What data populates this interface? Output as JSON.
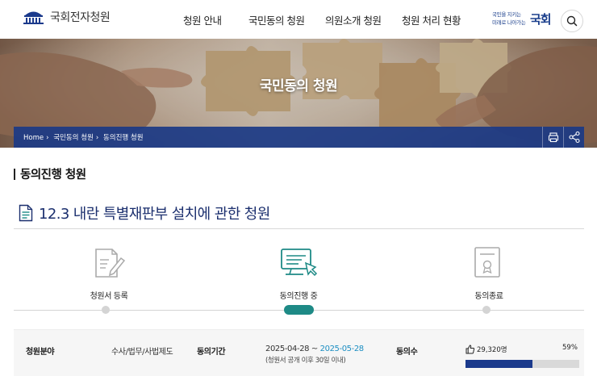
{
  "header": {
    "logo_text": "국회전자청원",
    "nav": [
      "청원 안내",
      "국민동의 청원",
      "의원소개 청원",
      "청원 처리 현황"
    ],
    "slogan_line1": "국민을 지키는",
    "slogan_line2": "미래로 나아가는",
    "slogan_brand": "국회",
    "search_icon": "search-icon"
  },
  "hero": {
    "title": "국민동의 청원",
    "breadcrumb": [
      "Home",
      "국민동의 청원",
      "동의진행 청원"
    ],
    "print_icon": "print-icon",
    "share_icon": "share-icon"
  },
  "content": {
    "section_title": "동의진행 청원",
    "petition_title": "12.3 내란 특별재판부 설치에 관한 청원",
    "document_icon": "document-icon"
  },
  "steps": [
    {
      "label": "청원서 등록",
      "icon": "pencil-document-icon",
      "active": false
    },
    {
      "label": "동의진행 중",
      "icon": "monitor-click-icon",
      "active": true
    },
    {
      "label": "동의종료",
      "icon": "certificate-icon",
      "active": false
    }
  ],
  "info": {
    "field_label": "청원분야",
    "field_value": "수사/법무/사법제도",
    "period_label": "동의기간",
    "period_start": "2025-04-28 ~ ",
    "period_end": "2025-05-28",
    "period_note": "(청원서 공개 이후 30일 이내)",
    "count_label": "동의수",
    "count_value": "29,320명",
    "percent_label": "59%",
    "progress": 0.59
  },
  "colors": {
    "navy": "#1b3a8c",
    "teal": "#1e8a86",
    "date_blue": "#1c8ec2"
  }
}
